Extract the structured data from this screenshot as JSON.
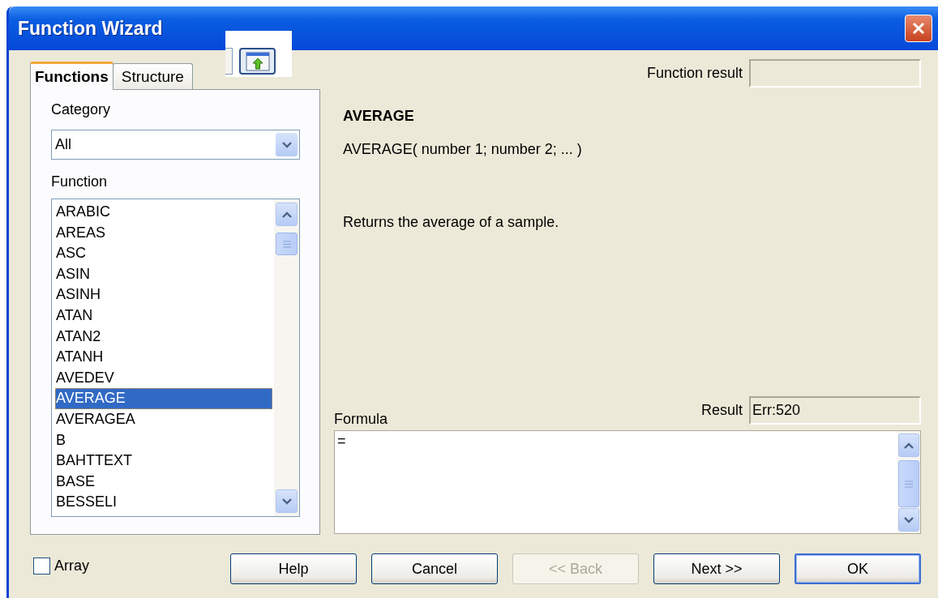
{
  "window": {
    "title": "Function Wizard"
  },
  "tabs": [
    {
      "label": "Functions",
      "selected": true
    },
    {
      "label": "Structure",
      "selected": false
    }
  ],
  "category": {
    "label": "Category",
    "value": "All"
  },
  "function_list": {
    "label": "Function",
    "items": [
      {
        "label": "ARABIC",
        "selected": false
      },
      {
        "label": "AREAS",
        "selected": false
      },
      {
        "label": "ASC",
        "selected": false
      },
      {
        "label": "ASIN",
        "selected": false
      },
      {
        "label": "ASINH",
        "selected": false
      },
      {
        "label": "ATAN",
        "selected": false
      },
      {
        "label": "ATAN2",
        "selected": false
      },
      {
        "label": "ATANH",
        "selected": false
      },
      {
        "label": "AVEDEV",
        "selected": false
      },
      {
        "label": "AVERAGE",
        "selected": true
      },
      {
        "label": "AVERAGEA",
        "selected": false
      },
      {
        "label": "B",
        "selected": false
      },
      {
        "label": "BAHTTEXT",
        "selected": false
      },
      {
        "label": "BASE",
        "selected": false
      },
      {
        "label": "BESSELI",
        "selected": false
      }
    ]
  },
  "array": {
    "label": "Array",
    "checked": false
  },
  "function_result": {
    "label": "Function result"
  },
  "function_name": "AVERAGE",
  "syntax": "AVERAGE( number 1; number 2; ... )",
  "description": "Returns the average of a sample.",
  "result": {
    "label": "Result",
    "value": "Err:520"
  },
  "formula": {
    "label": "Formula",
    "value": "="
  },
  "buttons": [
    {
      "label": "Help",
      "disabled": false,
      "default": false
    },
    {
      "label": "Cancel",
      "disabled": false,
      "default": false
    },
    {
      "label": "<< Back",
      "disabled": true,
      "default": false
    },
    {
      "label": "Next >>",
      "disabled": false,
      "default": false
    },
    {
      "label": "OK",
      "disabled": false,
      "default": true
    }
  ]
}
